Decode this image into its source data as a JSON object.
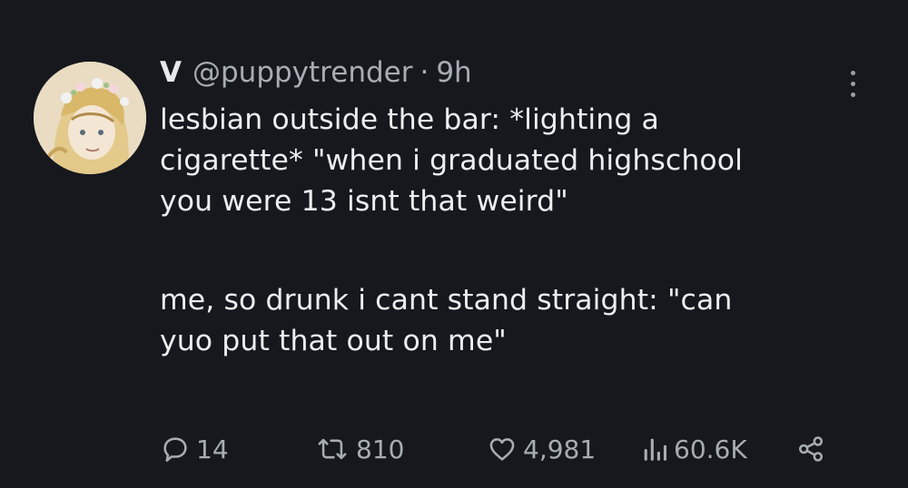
{
  "author": {
    "display_name": "V",
    "handle": "@puppytrender",
    "separator": "·",
    "time": "9h"
  },
  "tweet": {
    "lines_part1": [
      "lesbian outside the bar: *lighting a",
      "cigarette* \"when i graduated highschool",
      "you were 13 isnt that weird\""
    ],
    "lines_part2": [
      "me, so drunk i cant stand straight: \"can",
      "yuo put that out on me\""
    ]
  },
  "actions": {
    "replies": "14",
    "retweets": "810",
    "likes": "4,981",
    "views": "60.6K"
  },
  "icons": {
    "reply": "reply-bubble-icon",
    "retweet": "retweet-arrows-icon",
    "like": "heart-icon",
    "views": "bar-chart-icon",
    "share": "share-nodes-icon",
    "more": "more-vertical-icon"
  },
  "colors": {
    "background": "#16181d",
    "text": "#e7e9ea",
    "muted": "#a7adb3"
  }
}
